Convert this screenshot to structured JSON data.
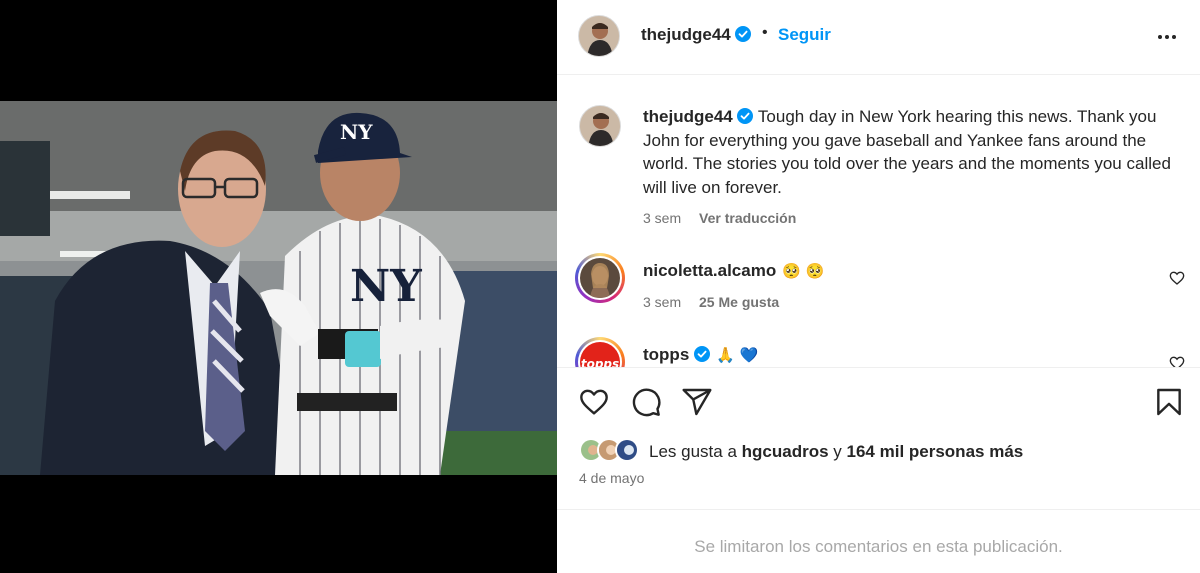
{
  "post": {
    "username": "thejudge44",
    "follow_label": "Seguir",
    "separator": "•",
    "caption": "Tough day in New York hearing this news. Thank you John for everything you gave baseball and Yankee fans around the world. The stories you told over the years and the moments you called will live on forever.",
    "caption_age": "3 sem",
    "translate_label": "Ver traducción"
  },
  "comments": [
    {
      "username": "nicoletta.alcamo",
      "emoji": "🥺 🥺",
      "age": "3 sem",
      "likes": "25 Me gusta"
    },
    {
      "username": "topps",
      "emoji": "🙏 💙"
    }
  ],
  "likes": {
    "prefix": "Les gusta a",
    "user": "hgcuadros",
    "conj": "y",
    "others": "164 mil personas más"
  },
  "date": "4 de mayo",
  "comments_limited": "Se limitaron los comentarios en esta publicación.",
  "colors": {
    "accent": "#0095f6",
    "verified": "#0095f6",
    "muted": "#737373"
  },
  "icons": [
    "verified-icon",
    "more-options-icon",
    "heart-icon",
    "comment-icon",
    "share-icon",
    "save-icon"
  ]
}
